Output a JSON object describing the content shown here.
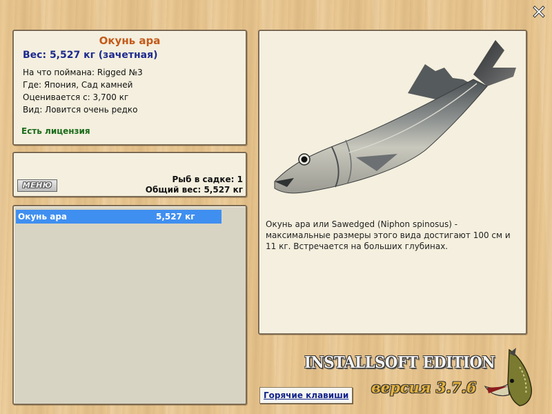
{
  "info": {
    "fish_name": "Окунь ара",
    "weight_line": "Вес: 5,527 кг (зачетная)",
    "caught_on": "На что поймана: Rigged №3",
    "location": "Где: Япония, Сад камней",
    "valued_from": "Оценивается с: 3,700 кг",
    "rarity": "Вид: Ловится очень редко",
    "license": "Есть лицензия"
  },
  "cage": {
    "menu_label": "МЕНЮ",
    "fish_count": "Рыб в садке: 1",
    "total_weight": "Общий вес: 5,527 кг"
  },
  "list": {
    "items": [
      {
        "name": "Окунь ара",
        "weight": "5,527 кг",
        "selected": true
      }
    ]
  },
  "description": "Окунь ара или Sawedged (Niphon spinosus) - максимальные размеры этого вида достигают 100 см и 11 кг. Встречается на больших глубинах.",
  "branding": {
    "edition": "INSTALLSOFT EDITION",
    "version": "версия 3.7.6"
  },
  "hotkeys_label": "Горячие клавиши",
  "colors": {
    "fish_name": "#c45a1a",
    "weight": "#1d2a8f",
    "license": "#1a6b1a",
    "selection": "#3f8ff0"
  }
}
